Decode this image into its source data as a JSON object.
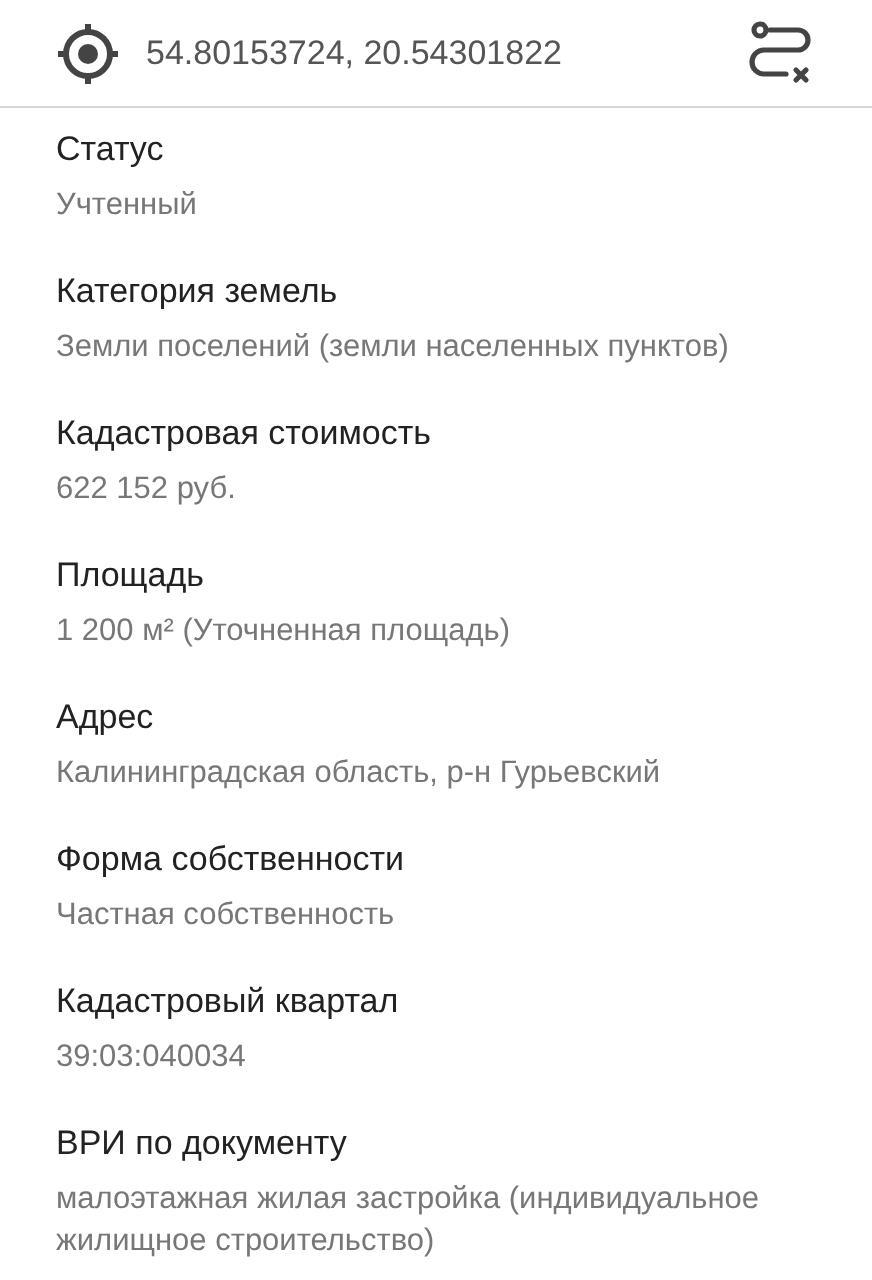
{
  "header": {
    "coordinates": "54.80153724, 20.54301822"
  },
  "fields": [
    {
      "label": "Статус",
      "value": "Учтенный"
    },
    {
      "label": "Категория земель",
      "value": "Земли поселений (земли населенных пунктов)"
    },
    {
      "label": "Кадастровая стоимость",
      "value": "622 152 руб."
    },
    {
      "label": "Площадь",
      "value": "1 200 м² (Уточненная площадь)"
    },
    {
      "label": "Адрес",
      "value": "Калининградская область, р-н Гурьевский"
    },
    {
      "label": "Форма собственности",
      "value": "Частная собственность"
    },
    {
      "label": "Кадастровый квартал",
      "value": "39:03:040034"
    },
    {
      "label": "ВРИ по документу",
      "value": "малоэтажная жилая застройка (индивидуальное жилищное строительство)"
    }
  ]
}
